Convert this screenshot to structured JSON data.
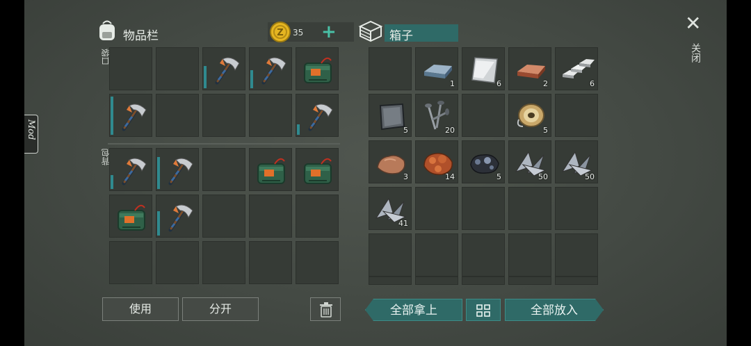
{
  "inventory": {
    "title": "物品栏",
    "pocket_label": "口袋",
    "backpack_label": "背包"
  },
  "currency": {
    "amount": "35",
    "add_symbol": "+"
  },
  "chest": {
    "title": "箱子"
  },
  "mod_tab": {
    "label": "Mod"
  },
  "close": {
    "symbol": "✕",
    "label": "关闭"
  },
  "buttons": {
    "use": "使用",
    "split": "分开",
    "take_all": "全部拿上",
    "put_all": "全部放入"
  },
  "pocket_slots": [
    {
      "item": "empty"
    },
    {
      "item": "empty"
    },
    {
      "item": "pickaxe-icon",
      "durability": 0.55
    },
    {
      "item": "pickaxe-icon",
      "durability": 0.45
    },
    {
      "item": "explosive-pack-icon"
    },
    {
      "item": "pickaxe-icon",
      "durability": 0.95
    },
    {
      "item": "empty"
    },
    {
      "item": "empty"
    },
    {
      "item": "empty"
    },
    {
      "item": "pickaxe-icon",
      "durability": 0.25
    }
  ],
  "backpack_slots": [
    {
      "item": "pickaxe-icon",
      "durability": 0.35
    },
    {
      "item": "pickaxe-icon",
      "durability": 0.8
    },
    {
      "item": "empty"
    },
    {
      "item": "explosive-pack-icon"
    },
    {
      "item": "explosive-pack-icon"
    },
    {
      "item": "explosive-pack-icon"
    },
    {
      "item": "pickaxe-icon",
      "durability": 0.6
    },
    {
      "item": "empty"
    },
    {
      "item": "empty"
    },
    {
      "item": "empty"
    },
    {
      "item": "empty"
    },
    {
      "item": "empty"
    },
    {
      "item": "empty"
    },
    {
      "item": "empty"
    },
    {
      "item": "empty"
    }
  ],
  "chest_slots": [
    {
      "item": "empty"
    },
    {
      "item": "iron-ingot-icon",
      "qty": "1"
    },
    {
      "item": "metal-sheet-icon",
      "qty": "6"
    },
    {
      "item": "copper-ingot-icon",
      "qty": "2"
    },
    {
      "item": "silver-bars-icon",
      "qty": "6"
    },
    {
      "item": "metal-plate-icon",
      "qty": "5"
    },
    {
      "item": "nails-icon",
      "qty": "20"
    },
    {
      "item": "empty"
    },
    {
      "item": "wire-spool-icon",
      "qty": "5"
    },
    {
      "item": "empty"
    },
    {
      "item": "stone-icon",
      "qty": "3"
    },
    {
      "item": "copper-ore-icon",
      "qty": "14"
    },
    {
      "item": "iron-ore-icon",
      "qty": "5"
    },
    {
      "item": "scrap-metal-icon",
      "qty": "50"
    },
    {
      "item": "scrap-metal-icon",
      "qty": "50"
    },
    {
      "item": "scrap-metal-icon",
      "qty": "41"
    },
    {
      "item": "empty"
    },
    {
      "item": "empty"
    },
    {
      "item": "empty"
    },
    {
      "item": "empty"
    },
    {
      "item": "empty"
    },
    {
      "item": "empty"
    },
    {
      "item": "empty"
    },
    {
      "item": "empty"
    },
    {
      "item": "empty"
    }
  ],
  "colors": {
    "accent_teal": "#2f6a67",
    "durability": "#2f8a8f",
    "coin": "#e5b521"
  }
}
